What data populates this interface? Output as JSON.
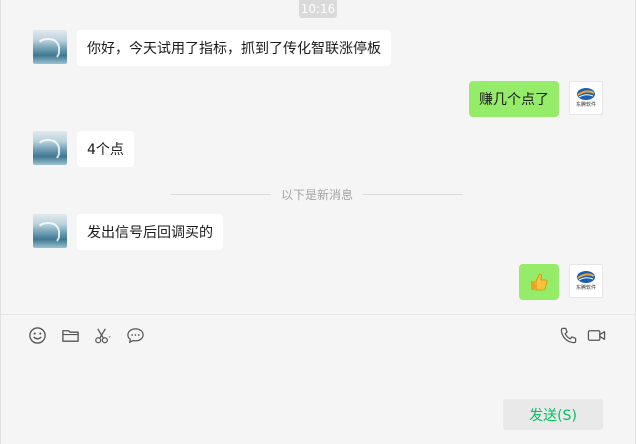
{
  "chat": {
    "time": "10:16",
    "new_messages_label": "以下是新消息",
    "messages": [
      {
        "side": "left",
        "text": "你好，今天试用了指标，抓到了传化智联涨停板"
      },
      {
        "side": "right",
        "text": "赚几个点了"
      },
      {
        "side": "left",
        "text": "4个点"
      },
      {
        "side": "left",
        "text": "发出信号后回调买的"
      },
      {
        "side": "right",
        "text": "",
        "icon": "thumbs-up-icon"
      }
    ],
    "self_avatar_text": "东腾软件"
  },
  "toolbar": {
    "left_icons": [
      "emoji-icon",
      "folder-icon",
      "scissors-icon",
      "chat-bubble-icon"
    ],
    "right_icons": [
      "phone-icon",
      "video-icon"
    ]
  },
  "input": {
    "send_label": "发送(S)"
  },
  "colors": {
    "background": "#f5f5f5",
    "self_bubble": "#95ec69",
    "other_bubble": "#ffffff",
    "send_text": "#07c160"
  }
}
